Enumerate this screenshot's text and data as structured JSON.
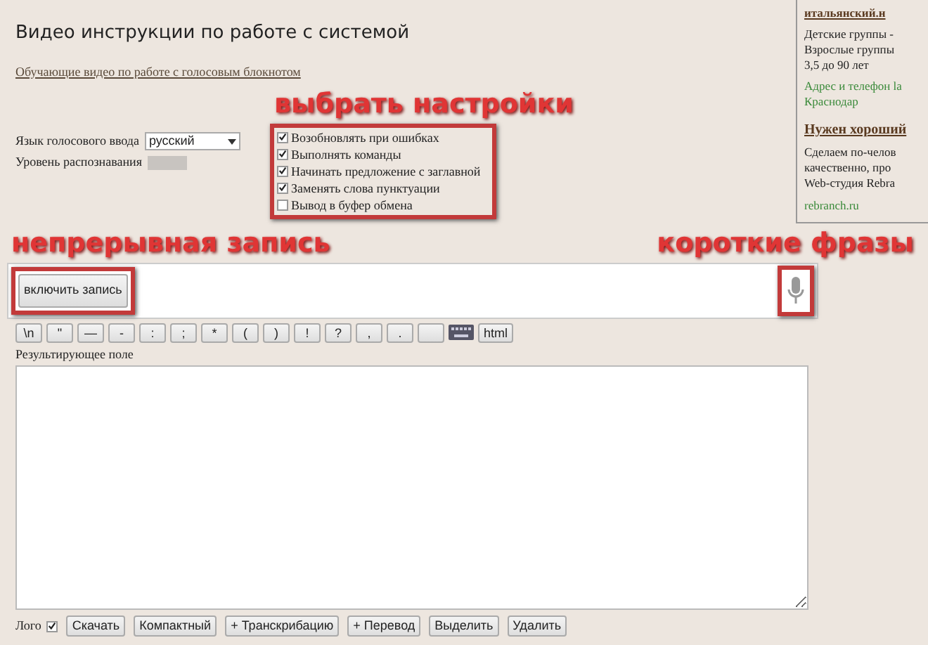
{
  "page_title": "Видео инструкции по работе с системой",
  "video_link": "Обучающие видео по работе с голосовым блокнотом",
  "settings_annotation": "выбрать настройки",
  "language": {
    "label": "Язык голосового ввода",
    "value": "русский"
  },
  "recognition_level": {
    "label": "Уровень распознавания"
  },
  "options": [
    {
      "label": "Возобновлять при ошибках",
      "checked": true
    },
    {
      "label": "Выполнять команды",
      "checked": true
    },
    {
      "label": "Начинать предложение с заглавной",
      "checked": true
    },
    {
      "label": "Заменять слова пунктуации",
      "checked": true
    },
    {
      "label": "Вывод в буфер обмена",
      "checked": false
    }
  ],
  "sidebar": {
    "link": "итальянский.н",
    "lines": [
      "Детские группы -",
      "Взрослые группы",
      "3,5 до 90 лет"
    ],
    "address": "Адрес и телефон  la",
    "city": "Краснодар",
    "heading": "Нужен хороший",
    "text_lines": [
      "Сделаем по-челов",
      "качественно, про",
      "Web-студия Rebra"
    ],
    "site": "rebranch.ru"
  },
  "continuous_annotation": "непрерывная запись",
  "short_annotation": "короткие фразы",
  "record_button": "включить запись",
  "symbol_keys": [
    {
      "label": "\\n"
    },
    {
      "label": "\""
    },
    {
      "label": "—"
    },
    {
      "label": "-"
    },
    {
      "label": ":"
    },
    {
      "label": ";"
    },
    {
      "label": "*"
    },
    {
      "label": "("
    },
    {
      "label": ")"
    },
    {
      "label": "!"
    },
    {
      "label": "?"
    },
    {
      "label": ","
    },
    {
      "label": "."
    }
  ],
  "html_button": "html",
  "result_label": "Результирующее поле",
  "logo": {
    "label": "Лого",
    "checked": true
  },
  "bottom_buttons": [
    "Скачать",
    "Компактный",
    "+ Транскрибацию",
    "+ Перевод",
    "Выделить",
    "Удалить"
  ]
}
